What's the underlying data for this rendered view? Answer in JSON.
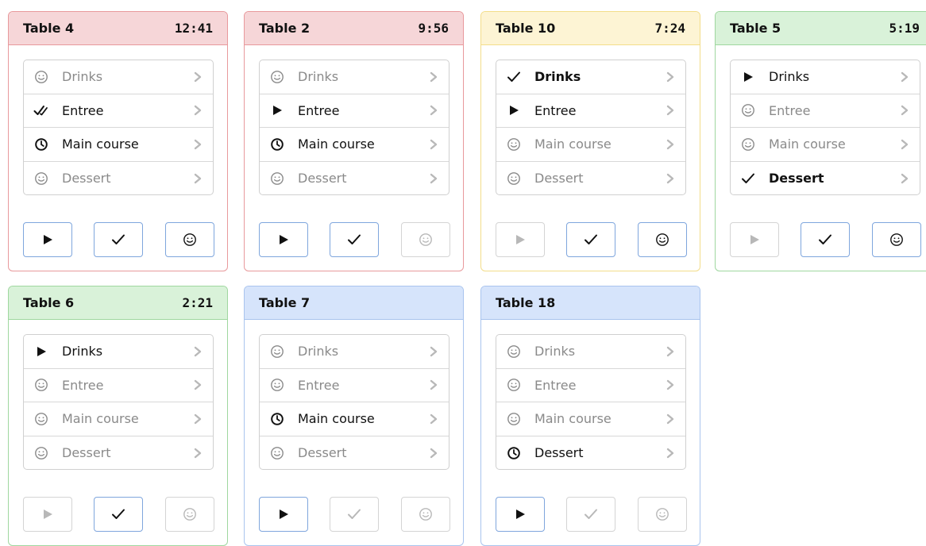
{
  "cards": [
    {
      "table": "Table 4",
      "timer": "12:41",
      "color": "red",
      "courses": [
        {
          "label": "Drinks",
          "status": "pending"
        },
        {
          "label": "Entree",
          "status": "served"
        },
        {
          "label": "Main course",
          "status": "waiting"
        },
        {
          "label": "Dessert",
          "status": "pending"
        }
      ],
      "actions": {
        "start": true,
        "done": true,
        "smile": true
      }
    },
    {
      "table": "Table 2",
      "timer": "9:56",
      "color": "red",
      "courses": [
        {
          "label": "Drinks",
          "status": "pending"
        },
        {
          "label": "Entree",
          "status": "active"
        },
        {
          "label": "Main course",
          "status": "waiting"
        },
        {
          "label": "Dessert",
          "status": "pending"
        }
      ],
      "actions": {
        "start": true,
        "done": true,
        "smile": false
      }
    },
    {
      "table": "Table 10",
      "timer": "7:24",
      "color": "yellow",
      "courses": [
        {
          "label": "Drinks",
          "status": "done"
        },
        {
          "label": "Entree",
          "status": "active"
        },
        {
          "label": "Main course",
          "status": "pending"
        },
        {
          "label": "Dessert",
          "status": "pending"
        }
      ],
      "actions": {
        "start": false,
        "done": true,
        "smile": true
      }
    },
    {
      "table": "Table 5",
      "timer": "5:19",
      "color": "green",
      "courses": [
        {
          "label": "Drinks",
          "status": "active"
        },
        {
          "label": "Entree",
          "status": "pending"
        },
        {
          "label": "Main course",
          "status": "pending"
        },
        {
          "label": "Dessert",
          "status": "done"
        }
      ],
      "actions": {
        "start": false,
        "done": true,
        "smile": true
      }
    },
    {
      "table": "Table 6",
      "timer": "2:21",
      "color": "green",
      "courses": [
        {
          "label": "Drinks",
          "status": "active"
        },
        {
          "label": "Entree",
          "status": "pending"
        },
        {
          "label": "Main course",
          "status": "pending"
        },
        {
          "label": "Dessert",
          "status": "pending"
        }
      ],
      "actions": {
        "start": false,
        "done": true,
        "smile": false
      }
    },
    {
      "table": "Table 7",
      "timer": "",
      "color": "blue",
      "courses": [
        {
          "label": "Drinks",
          "status": "pending"
        },
        {
          "label": "Entree",
          "status": "pending"
        },
        {
          "label": "Main course",
          "status": "waiting"
        },
        {
          "label": "Dessert",
          "status": "pending"
        }
      ],
      "actions": {
        "start": true,
        "done": false,
        "smile": false
      }
    },
    {
      "table": "Table 18",
      "timer": "",
      "color": "blue",
      "courses": [
        {
          "label": "Drinks",
          "status": "pending"
        },
        {
          "label": "Entree",
          "status": "pending"
        },
        {
          "label": "Main course",
          "status": "pending"
        },
        {
          "label": "Dessert",
          "status": "waiting"
        }
      ],
      "actions": {
        "start": true,
        "done": false,
        "smile": false
      }
    }
  ],
  "icons": {
    "pending": "smiley-icon",
    "served": "double-check-icon",
    "waiting": "clock-icon",
    "active": "play-icon",
    "done": "check-icon",
    "chevron": "chevron-right-icon"
  },
  "colors": {
    "red": "#f6d6d8",
    "yellow": "#fdf4d4",
    "green": "#d9f2d9",
    "blue": "#d6e4fb",
    "button_border": "#7fa6dd"
  }
}
